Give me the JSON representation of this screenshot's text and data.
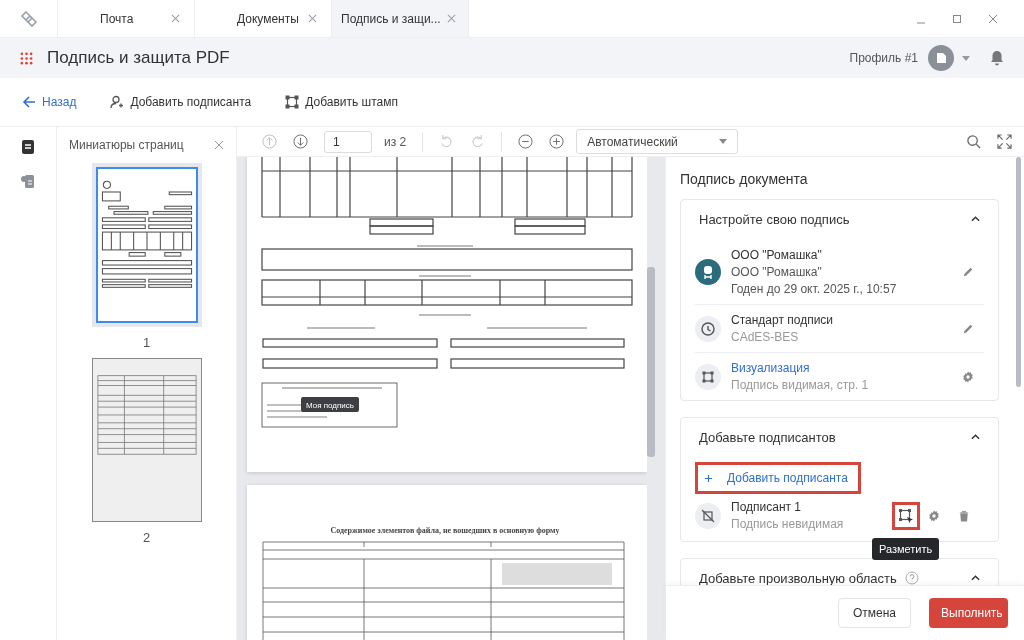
{
  "tabs": [
    {
      "label": "Почта",
      "selected": false
    },
    {
      "label": "Документы",
      "selected": false
    },
    {
      "label": "Подпись и защи...",
      "selected": true
    }
  ],
  "app": {
    "title": "Подпись и защита PDF",
    "profile": "Профиль #1"
  },
  "actions": [
    {
      "label": "Назад",
      "kind": "back"
    },
    {
      "label": "Добавить подписанта",
      "kind": "signer"
    },
    {
      "label": "Добавить штамп",
      "kind": "stamp"
    }
  ],
  "thumbnails": {
    "title": "Миниатюры страниц",
    "pages": [
      {
        "number": "1",
        "selected": true
      },
      {
        "number": "2",
        "selected": false
      }
    ]
  },
  "viewer": {
    "page": "1",
    "of": "из 2",
    "zoom": "Автоматический",
    "page1": {
      "stamp_label": "Моя подпись"
    },
    "page2": {
      "heading": "Содержимое элементов файла, не вошедших в основную форму"
    }
  },
  "panel": {
    "title": "Подпись документа",
    "settings": {
      "title": "Настройте свою подпись",
      "expanded": true,
      "rows": [
        {
          "kind": "certificate",
          "title": "ООО \"Ромашка\"",
          "lines": [
            "ООО \"Ромашка\"",
            "Годен до 29 окт. 2025 г., 10:57"
          ]
        },
        {
          "kind": "standard",
          "title": "Стандарт подписи",
          "lines": [
            "CAdES-BES"
          ]
        },
        {
          "kind": "visual",
          "title": "Визуализация",
          "lines": [
            "Подпись видимая, стр. 1"
          ]
        }
      ]
    },
    "signers": {
      "title": "Добавьте подписантов",
      "expanded": true,
      "add": {
        "label": "Добавить подписанта",
        "highlighted": true
      },
      "items": [
        {
          "title": "Подписант 1",
          "subtitle": "Подпись невидимая",
          "markup_highlighted": true,
          "tooltip": "Разметить"
        }
      ]
    },
    "area": {
      "title": "Добавьте произвольную область",
      "expanded": true
    }
  },
  "footer": {
    "cancel": "Отмена",
    "submit": "Выполнить"
  }
}
